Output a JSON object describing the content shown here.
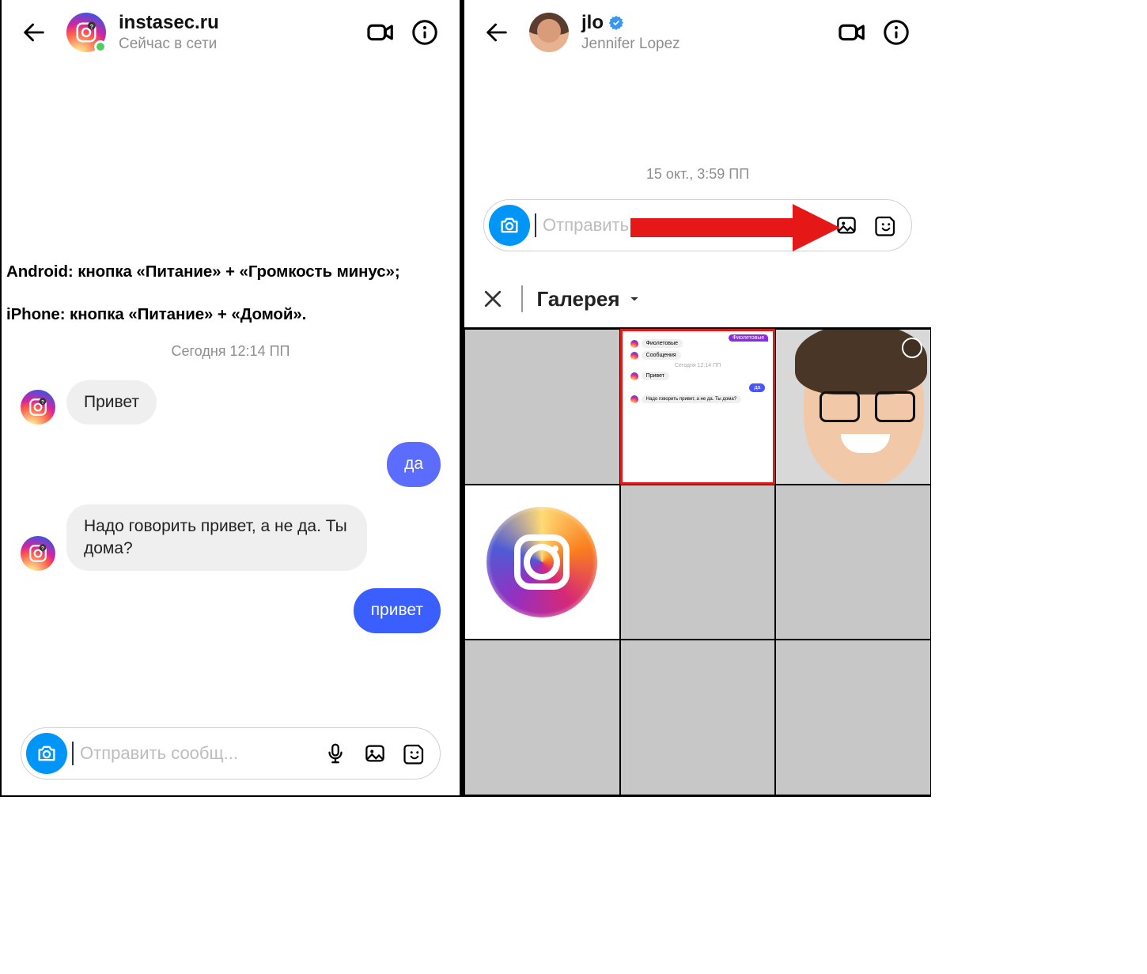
{
  "caption": {
    "line1": "Android: кнопка «Питание» + «Громкость минус»;",
    "line2": "iPhone: кнопка «Питание» + «Домой»."
  },
  "left": {
    "header": {
      "username": "instasec.ru",
      "status": "Сейчас в сети"
    },
    "timestamp": "Сегодня 12:14 ПП",
    "messages": {
      "m1": "Привет",
      "m2": "да",
      "m3": "Надо говорить привет, а не да. Ты дома?",
      "m4": "привет"
    },
    "composer": {
      "placeholder": "Отправить сообщ..."
    }
  },
  "right": {
    "header": {
      "username": "jlo",
      "subtitle": "Jennifer Lopez"
    },
    "timestamp": "15 окт., 3:59 ПП",
    "composer": {
      "placeholder": "Отправить"
    },
    "gallery_title": "Галерея",
    "thumb": {
      "tag": "Фиолетовые",
      "l1": "Фиолетовые",
      "l2": "Сообщения",
      "ts": "Сегодня 12:14 ПП",
      "l3": "Привет",
      "l4": "да",
      "l5": "Надо говорить привет, а не да. Ты дома?"
    }
  }
}
